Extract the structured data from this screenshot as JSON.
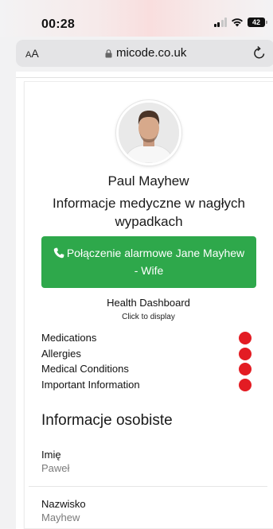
{
  "status_bar": {
    "time": "00:28",
    "battery": "42"
  },
  "browser": {
    "text_size_label_small": "A",
    "text_size_label_large": "A",
    "url": "micode.co.uk"
  },
  "profile": {
    "name": "Paul Mayhew",
    "subtitle": "Informacje medyczne w nagłych wypadkach"
  },
  "emergency_call": {
    "label": "Połączenie alarmowe Jane Mayhew - Wife",
    "color": "#2ea84b"
  },
  "health_dashboard": {
    "title": "Health Dashboard",
    "hint": "Click to display",
    "items": [
      {
        "label": "Medications",
        "status_color": "#e31c23"
      },
      {
        "label": "Allergies",
        "status_color": "#e31c23"
      },
      {
        "label": "Medical Conditions",
        "status_color": "#e31c23"
      },
      {
        "label": "Important Information",
        "status_color": "#e31c23"
      }
    ]
  },
  "personal_info": {
    "title": "Informacje osobiste",
    "fields": [
      {
        "label": "Imię",
        "value": "Paweł"
      },
      {
        "label": "Nazwisko",
        "value": "Mayhew"
      }
    ]
  }
}
